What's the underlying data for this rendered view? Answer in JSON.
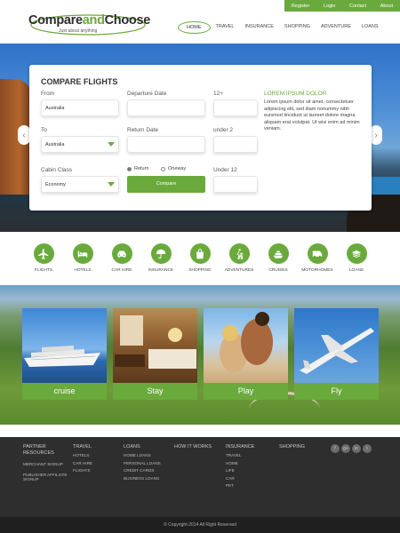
{
  "topbar": {
    "links": [
      "Register",
      "Login",
      "Contact",
      "About"
    ]
  },
  "logo": {
    "part1": "Compare",
    "part2": "and",
    "part3": "Choose",
    "tagline": "Just about anything"
  },
  "nav": {
    "items": [
      "HOME",
      "TRAVEL",
      "INSURANCE",
      "SHOPPING",
      "ADVENTURE",
      "LOANS"
    ]
  },
  "search": {
    "title": "COMPARE FLIGHTS",
    "from_label": "From",
    "from_value": "Australia",
    "departure_label": "Departure Date",
    "adults_label": "12+",
    "to_label": "To",
    "to_value": "Australia",
    "return_label": "Return Date",
    "under2_label": "under 2",
    "cabin_label": "Cabin Class",
    "cabin_value": "Economy",
    "trip_return": "Return",
    "trip_oneway": "Oneway",
    "under12_label": "Under 12",
    "compare_button": "Compare"
  },
  "promo": {
    "title": "LOREM IPSUM DOLOR",
    "body": "Lorem ipsum dolor sit amet, consectetuer adipiscing elit, sed diam nonummy nibh euismod tincidunt ut laoreet dolore magna aliquam erat volutpat. Ut wisi enim ad minim veniam."
  },
  "categories": [
    {
      "label": "FLIGHTS",
      "icon": "plane-icon"
    },
    {
      "label": "HOTELS",
      "icon": "bed-icon"
    },
    {
      "label": "CAR HIRE",
      "icon": "car-icon"
    },
    {
      "label": "INSURANCE",
      "icon": "umbrella-icon"
    },
    {
      "label": "SHOPPING",
      "icon": "shopping-bag-icon"
    },
    {
      "label": "ADVENTURES",
      "icon": "hiking-icon"
    },
    {
      "label": "CRUISES",
      "icon": "ship-icon"
    },
    {
      "label": "MOTORHOMES",
      "icon": "motorhome-icon"
    },
    {
      "label": "LOANS",
      "icon": "money-icon"
    }
  ],
  "features": [
    "cruise",
    "Stay",
    "Play",
    "Fly"
  ],
  "footer": {
    "partner_title": "PARTNER RESOURCES",
    "partner_items": [
      "MERCHANT SIGNUP",
      "PUBLISHER AFFILIATE SIGNUP"
    ],
    "travel_title": "TRAVEL",
    "travel_items": [
      "HOTELS",
      "CAR HIRE",
      "FLIGHTS"
    ],
    "loans_title": "LOANS",
    "loans_items": [
      "HOME LOANS",
      "PERSONAL LOANS",
      "CREDIT CARDS",
      "BUSINESS LOANS"
    ],
    "how_title": "HOW IT WORKS",
    "insurance_title": "INSURANCE",
    "insurance_items": [
      "TRAVEL",
      "HOME",
      "LIFE",
      "CAR",
      "PET"
    ],
    "shopping_title": "SHOPPING",
    "social": [
      "f",
      "g+",
      "in",
      "t"
    ],
    "copyright": "© Copyright-2014 All Right Reserved"
  },
  "colors": {
    "accent": "#6aaa3c",
    "footer": "#2e2e2e",
    "footer_bottom": "#1f1f1f"
  }
}
